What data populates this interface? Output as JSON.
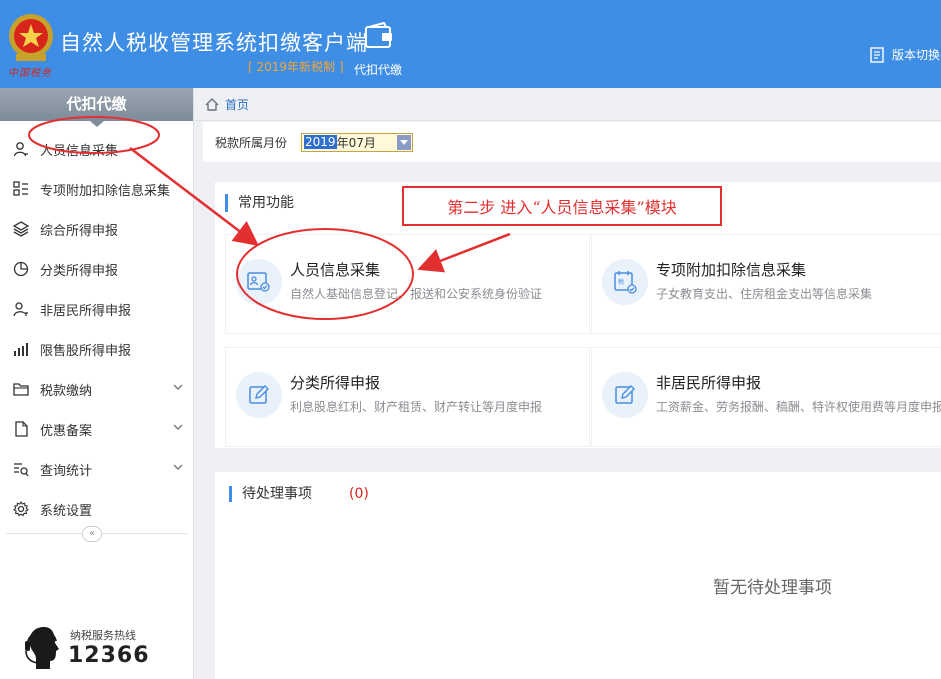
{
  "header": {
    "emblem_caption": "中国税务",
    "app_title": "自然人税收管理系统扣缴客户端",
    "badge": "[ 2019年新税制 ]",
    "module_label": "代扣代缴",
    "version_switch": "版本切换"
  },
  "sidebar": {
    "title": "代扣代缴",
    "items": [
      {
        "label": "人员信息采集",
        "icon": "person-icon"
      },
      {
        "label": "专项附加扣除信息采集",
        "icon": "grid-list-icon"
      },
      {
        "label": "综合所得申报",
        "icon": "layers-icon"
      },
      {
        "label": "分类所得申报",
        "icon": "pie-icon"
      },
      {
        "label": "非居民所得申报",
        "icon": "person-key-icon"
      },
      {
        "label": "限售股所得申报",
        "icon": "bar-chart-icon"
      },
      {
        "label": "税款缴纳",
        "icon": "folder-icon"
      },
      {
        "label": "优惠备案",
        "icon": "document-icon"
      },
      {
        "label": "查询统计",
        "icon": "search-list-icon"
      },
      {
        "label": "系统设置",
        "icon": "gear-icon"
      }
    ],
    "collapse_label": "«",
    "hotline_label": "纳税服务热线",
    "hotline_number": "12366"
  },
  "breadcrumb": {
    "home": "首页"
  },
  "period": {
    "label": "税款所属月份",
    "year": "2019",
    "rest": "年07月"
  },
  "functions": {
    "title": "常用功能",
    "cards": [
      {
        "title": "人员信息采集",
        "desc": "自然人基础信息登记、报送和公安系统身份验证",
        "icon": "id-card-icon"
      },
      {
        "title": "专项附加扣除信息采集",
        "desc": "子女教育支出、住房租金支出等信息采集",
        "icon": "calendar-deduction-icon"
      },
      {
        "title": "分类所得申报",
        "desc": "利息股息红利、财产租赁、财产转让等月度申报",
        "icon": "edit-icon"
      },
      {
        "title": "非居民所得申报",
        "desc": "工资薪金、劳务报酬、稿酬、特许权使用费等月度申报",
        "icon": "edit-icon"
      }
    ]
  },
  "pending": {
    "title": "待处理事项",
    "count": "(0)",
    "empty": "暂无待处理事项"
  },
  "annotation": {
    "text": "第二步  进入“人员信息采集”模块",
    "color": "#e23030"
  },
  "colors": {
    "header_bg": "#3f8ee6",
    "accent": "#3f8ee6",
    "badge": "#f3a53a",
    "count_red": "#d8251c"
  }
}
